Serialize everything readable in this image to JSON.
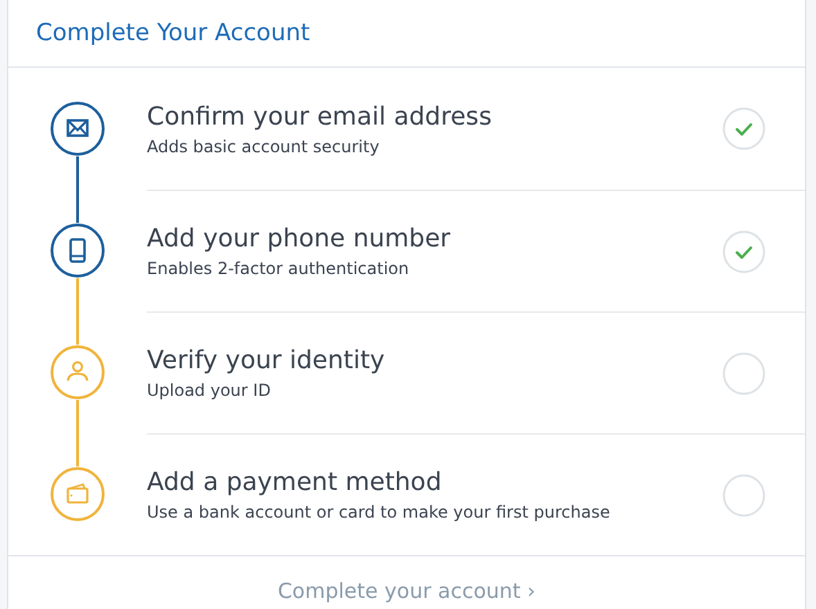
{
  "title": "Complete Your Account",
  "steps": [
    {
      "kind": "email",
      "title": "Confirm your email address",
      "subtitle": "Adds basic account security",
      "completed": true
    },
    {
      "kind": "phone",
      "title": "Add your phone number",
      "subtitle": "Enables 2-factor authentication",
      "completed": true
    },
    {
      "kind": "identity",
      "title": "Verify your identity",
      "subtitle": "Upload your ID",
      "completed": false
    },
    {
      "kind": "payment",
      "title": "Add a payment method",
      "subtitle": "Use a bank account or card to make your first purchase",
      "completed": false
    }
  ],
  "footer_link": "Complete your account ›"
}
